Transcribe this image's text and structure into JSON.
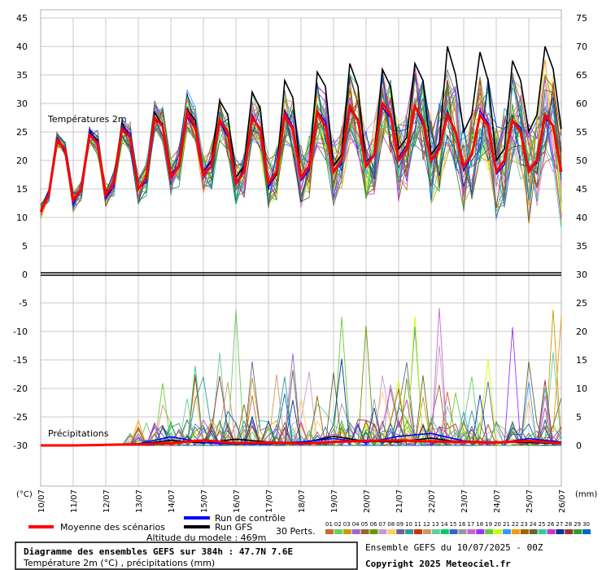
{
  "chart_data": {
    "type": "line",
    "title": "Diagramme des ensembles GEFS sur 384h : 47.7N 7.6E",
    "subtitle": "Température 2m (°C) , précipitations (mm)",
    "run_label": "Ensemble GEFS du 10/07/2025 - 00Z",
    "copyright": "Copyright 2025 Meteociel.fr",
    "altitude_label": "Altitude du modele : 469m",
    "panel_temp_label": "Températures 2m",
    "panel_precip_label": "Précipitations",
    "left_unit": "(°C)",
    "right_unit": "(mm)",
    "left_axis_ticks": [
      "45",
      "40",
      "35",
      "30",
      "25",
      "20",
      "15",
      "10",
      "5",
      "0",
      "-5",
      "-10",
      "-15",
      "-20",
      "-25",
      "-30"
    ],
    "right_axis_ticks": [
      "75",
      "70",
      "65",
      "60",
      "55",
      "50",
      "45",
      "40",
      "35",
      "30",
      "25",
      "20",
      "15",
      "10",
      "5",
      "0"
    ],
    "left_ylim": [
      -30,
      45
    ],
    "x_ticks": [
      "10/07",
      "11/07",
      "12/07",
      "13/07",
      "14/07",
      "15/07",
      "16/07",
      "17/07",
      "18/07",
      "19/07",
      "20/07",
      "21/07",
      "22/07",
      "23/07",
      "24/07",
      "25/07",
      "26/07"
    ],
    "legend": {
      "mean": "Moyenne des scénarios",
      "control": "Run de contrôle",
      "gfs": "Run GFS",
      "perts_label": "30 Perts.",
      "perts_numbers": [
        "01",
        "02",
        "03",
        "04",
        "05",
        "06",
        "07",
        "08",
        "09",
        "10",
        "11",
        "12",
        "13",
        "14",
        "15",
        "16",
        "17",
        "18",
        "19",
        "20",
        "21",
        "22",
        "23",
        "24",
        "25",
        "26",
        "27",
        "28",
        "29",
        "30"
      ],
      "perts_colors": [
        "#cc6633",
        "#66cc66",
        "#cc9900",
        "#9966cc",
        "#996633",
        "#669900",
        "#cc99cc",
        "#ffcc66",
        "#666699",
        "#339999",
        "#cc3300",
        "#cc9966",
        "#66cc99",
        "#00cc66",
        "#3366cc",
        "#999999",
        "#cc66cc",
        "#9933ff",
        "#66cc33",
        "#ccff00",
        "#3399ff",
        "#ff9900",
        "#996600",
        "#666633",
        "#33cc99",
        "#cc33cc",
        "#003399",
        "#993333",
        "#339933",
        "#0066cc"
      ]
    },
    "colors": {
      "mean": "#ff0000",
      "control": "#0000ff",
      "gfs": "#000000"
    },
    "temperature": {
      "x": [
        0,
        1,
        2,
        3,
        4,
        5,
        6,
        7,
        8,
        9,
        10,
        11,
        12,
        13,
        14,
        15,
        16,
        17,
        18,
        19,
        20,
        21,
        22,
        23,
        24,
        25,
        26,
        27,
        28,
        29,
        30,
        31,
        32,
        33,
        34,
        35,
        36,
        37,
        38,
        39,
        40,
        41,
        42,
        43,
        44,
        45,
        46,
        47,
        48,
        49,
        50,
        51,
        52,
        53,
        54,
        55,
        56,
        57,
        58,
        59,
        60,
        61,
        62,
        63,
        64
      ],
      "x_unit": "6-hour steps from 10/07 00Z",
      "mean": [
        11,
        14,
        23.5,
        22,
        13,
        15,
        24.5,
        23,
        14,
        16,
        25.5,
        24,
        15,
        17,
        27.5,
        26,
        17,
        19,
        28.5,
        26,
        17.5,
        19,
        27,
        25,
        16,
        18,
        27.5,
        25.5,
        16,
        18,
        28,
        25.5,
        17,
        19,
        28.5,
        26,
        18,
        20,
        29.5,
        27,
        19,
        21,
        30,
        28,
        20,
        22,
        29.5,
        27,
        20,
        22,
        28,
        25,
        19,
        21,
        28,
        26,
        18,
        20,
        27,
        25,
        18,
        20,
        28,
        26,
        18
      ],
      "gfs": [
        11,
        14,
        23.5,
        22,
        13,
        15,
        25,
        23.5,
        13.5,
        16,
        26.5,
        24,
        15,
        17,
        28.5,
        26,
        17,
        19,
        29,
        27,
        18,
        20,
        30.5,
        28,
        17,
        19,
        32,
        29,
        15.5,
        17.5,
        34,
        31,
        17,
        19,
        35.5,
        33,
        19,
        21,
        37,
        33,
        19,
        21,
        36,
        33,
        22,
        24,
        37,
        34,
        21,
        23,
        40,
        35,
        25,
        28,
        39,
        34,
        20,
        22,
        37.5,
        34,
        25,
        28,
        40,
        36,
        25.5
      ]
    },
    "precipitation": {
      "x": [
        0,
        4,
        8,
        12,
        16,
        20,
        24,
        28,
        32,
        36,
        40,
        44,
        48,
        52,
        56,
        60,
        64
      ],
      "mean": [
        0,
        0,
        0.1,
        0.2,
        0.4,
        0.9,
        0.4,
        0.5,
        0.3,
        0.6,
        0.8,
        0.9,
        0.7,
        0.6,
        0.5,
        0.8,
        0.4
      ],
      "control": [
        0,
        0,
        0.1,
        0.3,
        1.5,
        0.5,
        0.2,
        0.3,
        0.6,
        1.2,
        0.5,
        1.6,
        2.1,
        0.8,
        0.4,
        1.2,
        0.6
      ],
      "gfs": [
        0,
        0,
        0.1,
        0.2,
        0.9,
        0.4,
        1.1,
        0.6,
        0.4,
        1.6,
        0.7,
        0.6,
        1.3,
        0.5,
        0.6,
        0.5,
        0.3
      ],
      "member_peaks_mm": [
        12.5,
        4.5,
        7.5,
        15.5,
        17.5,
        26,
        10.5,
        9,
        12.5,
        13
      ]
    }
  }
}
